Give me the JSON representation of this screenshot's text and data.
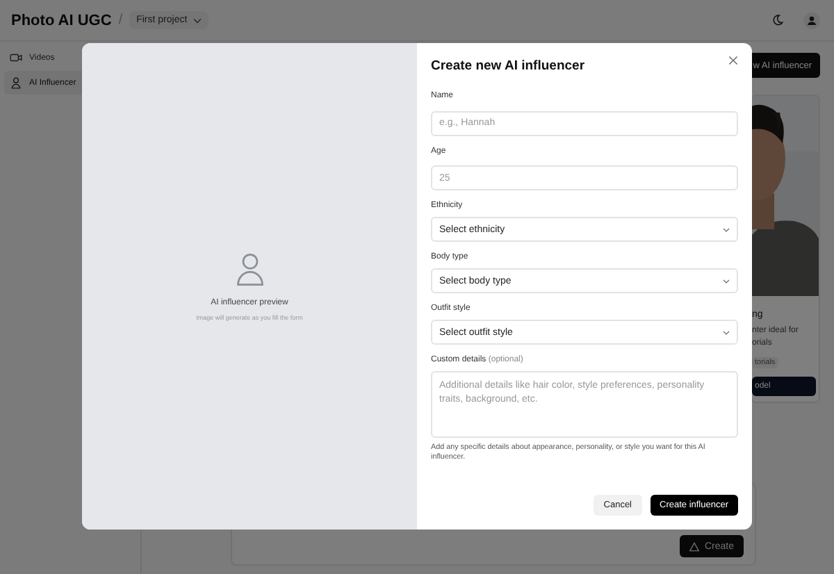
{
  "app": {
    "title": "Photo AI UGC",
    "separator": "/",
    "project": "First project"
  },
  "sidebar": {
    "items": [
      {
        "kind": "video",
        "label": "Videos",
        "selected": false
      },
      {
        "kind": "person",
        "label": "AI Influencer",
        "selected": true
      }
    ]
  },
  "main": {
    "new_button": "w AI influencer",
    "card": {
      "lines": [
        "ng",
        "nter ideal for",
        "orials"
      ],
      "tag": "torials",
      "button": "odel"
    },
    "create_button": "Create"
  },
  "modal": {
    "title": "Create new AI influencer",
    "preview": {
      "title": "AI influencer preview",
      "subtitle": "Image will generate as you fill the form"
    },
    "fields": [
      {
        "kind": "text",
        "label": "Name",
        "placeholder": "e.g., Hannah"
      },
      {
        "kind": "text",
        "label": "Age",
        "placeholder": "25"
      },
      {
        "kind": "select",
        "label": "Ethnicity",
        "value": "Select ethnicity"
      },
      {
        "kind": "select",
        "label": "Body type",
        "value": "Select body type"
      },
      {
        "kind": "select",
        "label": "Outfit style",
        "value": "Select outfit style"
      },
      {
        "kind": "textarea",
        "label": "Custom details",
        "note": "(optional)",
        "placeholder": "Additional details like hair color, style preferences, personality traits, background, etc.",
        "help": "Add any specific details about appearance, personality, or style you want for this AI influencer."
      }
    ],
    "buttons": [
      {
        "kind": "secondary",
        "label": "Cancel"
      },
      {
        "kind": "primary",
        "label": "Create influencer"
      }
    ]
  }
}
